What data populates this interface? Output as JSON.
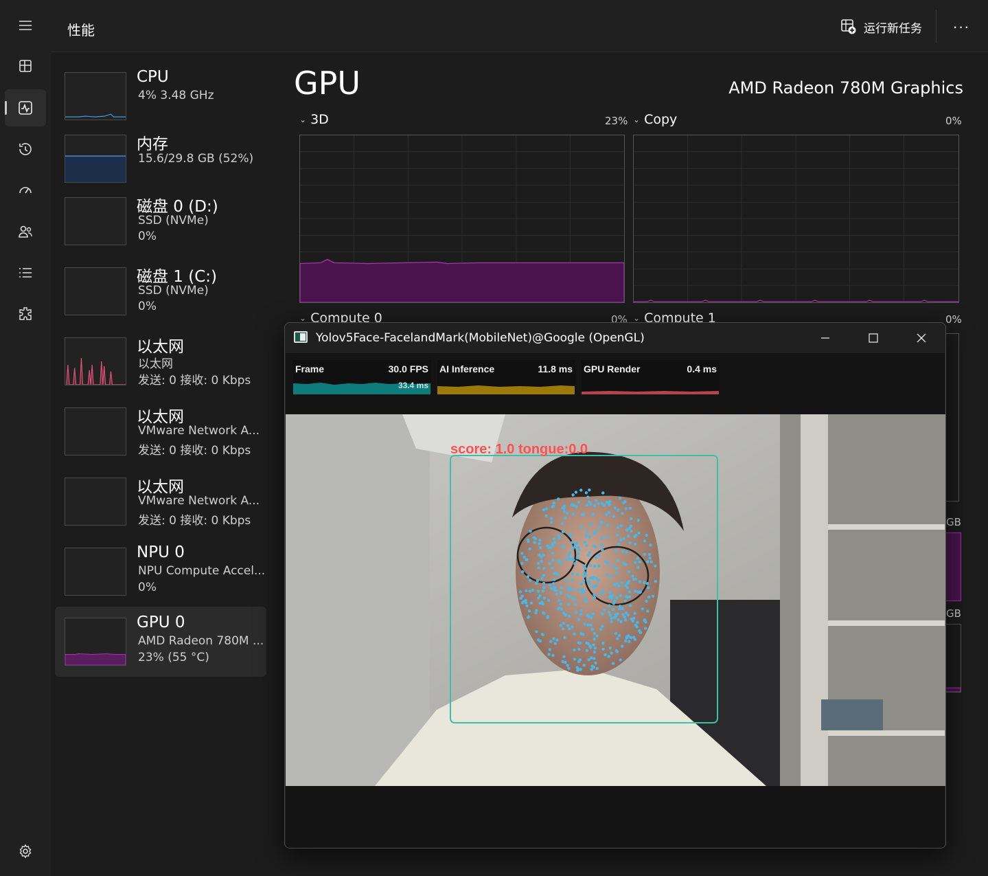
{
  "header": {
    "title": "性能",
    "run_task_label": "运行新任务",
    "more_label": "···"
  },
  "devices": [
    {
      "name": "CPU",
      "line1": "4%  3.48 GHz",
      "line2": ""
    },
    {
      "name": "内存",
      "line1": "15.6/29.8 GB (52%)",
      "line2": ""
    },
    {
      "name": "磁盘 0 (D:)",
      "line1": "SSD (NVMe)",
      "line2": "0%"
    },
    {
      "name": "磁盘 1 (C:)",
      "line1": "SSD (NVMe)",
      "line2": "0%"
    },
    {
      "name": "以太网",
      "line1": "以太网",
      "line2": "发送: 0 接收: 0 Kbps"
    },
    {
      "name": "以太网",
      "line1": "VMware Network A...",
      "line2": "发送: 0 接收: 0 Kbps"
    },
    {
      "name": "以太网",
      "line1": "VMware Network A...",
      "line2": "发送: 0 接收: 0 Kbps"
    },
    {
      "name": "NPU 0",
      "line1": "NPU Compute Accel...",
      "line2": "0%"
    },
    {
      "name": "GPU 0",
      "line1": "AMD Radeon 780M ...",
      "line2": "23%  (55 °C)"
    }
  ],
  "selected_device_index": 8,
  "gpu": {
    "title": "GPU",
    "model": "AMD Radeon 780M Graphics",
    "engines": [
      {
        "label": "3D",
        "percent": "23%"
      },
      {
        "label": "Copy",
        "percent": "0%"
      },
      {
        "label": "Compute 0",
        "percent": "0%"
      },
      {
        "label": "Compute 1",
        "percent": "0%"
      }
    ],
    "memory_unit_1": "GB",
    "memory_unit_2": "GB"
  },
  "app_window": {
    "title": "Yolov5Face-FacelandMark(MobileNet)@Google (OpenGL)",
    "stats": [
      {
        "label": "Frame",
        "value": "30.0 FPS",
        "sub": "33.4 ms",
        "color": "#0e7c7b"
      },
      {
        "label": "AI Inference",
        "value": "11.8 ms",
        "sub": "",
        "color": "#9c7a0a"
      },
      {
        "label": "GPU Render",
        "value": "0.4 ms",
        "sub": "",
        "color": "#b2444a"
      }
    ],
    "overlay_text": "score: 1.0 tongue:0.0"
  },
  "colors": {
    "gpu_accent": "#a336a8",
    "memory_accent": "#5b8bd6",
    "cpu_accent": "#3aa0d8",
    "net_accent": "#e0507a",
    "landmark": "#49b8e8",
    "face_box": "#3ec0a8"
  },
  "icons": [
    "hamburger-icon",
    "processes-icon",
    "performance-icon",
    "app-history-icon",
    "startup-apps-icon",
    "users-icon",
    "details-icon",
    "services-icon",
    "settings-icon",
    "run-task-icon"
  ]
}
